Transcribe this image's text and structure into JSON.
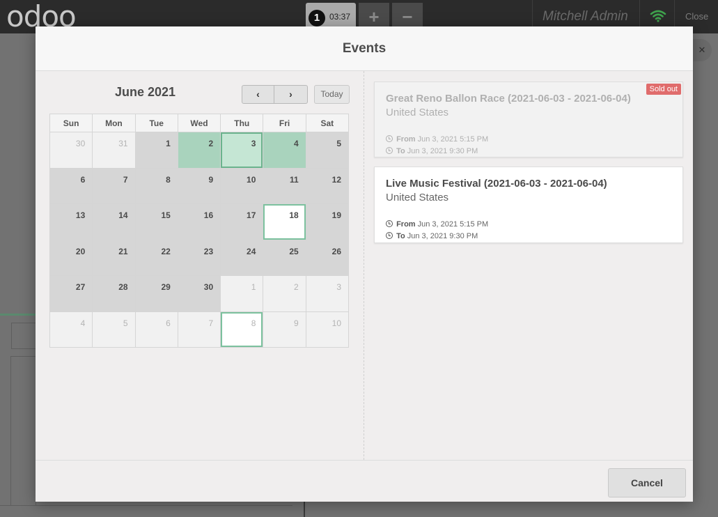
{
  "topbar": {
    "logo": "odoo",
    "order_number": "1",
    "order_time": "03:37",
    "add_label": "+",
    "remove_label": "−",
    "cashier": "Mitchell Admin",
    "close_label": "Close"
  },
  "modal": {
    "title": "Events",
    "cancel_label": "Cancel"
  },
  "calendar": {
    "month_label": "June 2021",
    "prev_label": "‹",
    "next_label": "›",
    "today_label": "Today",
    "weekdays": [
      "Sun",
      "Mon",
      "Tue",
      "Wed",
      "Thu",
      "Fri",
      "Sat"
    ],
    "weeks": [
      [
        {
          "d": "30",
          "s": "other"
        },
        {
          "d": "31",
          "s": "other"
        },
        {
          "d": "1",
          "s": ""
        },
        {
          "d": "2",
          "s": "event"
        },
        {
          "d": "3",
          "s": "selected"
        },
        {
          "d": "4",
          "s": "event"
        },
        {
          "d": "5",
          "s": ""
        }
      ],
      [
        {
          "d": "6",
          "s": ""
        },
        {
          "d": "7",
          "s": ""
        },
        {
          "d": "8",
          "s": ""
        },
        {
          "d": "9",
          "s": ""
        },
        {
          "d": "10",
          "s": ""
        },
        {
          "d": "11",
          "s": ""
        },
        {
          "d": "12",
          "s": ""
        }
      ],
      [
        {
          "d": "13",
          "s": ""
        },
        {
          "d": "14",
          "s": ""
        },
        {
          "d": "15",
          "s": ""
        },
        {
          "d": "16",
          "s": ""
        },
        {
          "d": "17",
          "s": ""
        },
        {
          "d": "18",
          "s": "today"
        },
        {
          "d": "19",
          "s": ""
        }
      ],
      [
        {
          "d": "20",
          "s": ""
        },
        {
          "d": "21",
          "s": ""
        },
        {
          "d": "22",
          "s": ""
        },
        {
          "d": "23",
          "s": ""
        },
        {
          "d": "24",
          "s": ""
        },
        {
          "d": "25",
          "s": ""
        },
        {
          "d": "26",
          "s": ""
        }
      ],
      [
        {
          "d": "27",
          "s": ""
        },
        {
          "d": "28",
          "s": ""
        },
        {
          "d": "29",
          "s": ""
        },
        {
          "d": "30",
          "s": ""
        },
        {
          "d": "1",
          "s": "other"
        },
        {
          "d": "2",
          "s": "other"
        },
        {
          "d": "3",
          "s": "other"
        }
      ],
      [
        {
          "d": "4",
          "s": "other"
        },
        {
          "d": "5",
          "s": "other"
        },
        {
          "d": "6",
          "s": "other"
        },
        {
          "d": "7",
          "s": "other"
        },
        {
          "d": "8",
          "s": "other today"
        },
        {
          "d": "9",
          "s": "other"
        },
        {
          "d": "10",
          "s": "other"
        }
      ]
    ]
  },
  "events": [
    {
      "title": "Great Reno Ballon Race (2021-06-03 - 2021-06-04)",
      "country": "United States",
      "from_label": "From",
      "from_value": "Jun 3, 2021 5:15 PM",
      "to_label": "To",
      "to_value": "Jun 3, 2021 9:30 PM",
      "badge": "Sold out"
    },
    {
      "title": "Live Music Festival (2021-06-03 - 2021-06-04)",
      "country": "United States",
      "from_label": "From",
      "from_value": "Jun 3, 2021 5:15 PM",
      "to_label": "To",
      "to_value": "Jun 3, 2021 9:30 PM"
    }
  ],
  "colors": {
    "event_day": "#a9d3bd",
    "selected_border": "#6bb38d",
    "sold_out_badge": "#e06c6c",
    "wifi_status": "#3fa34d"
  }
}
